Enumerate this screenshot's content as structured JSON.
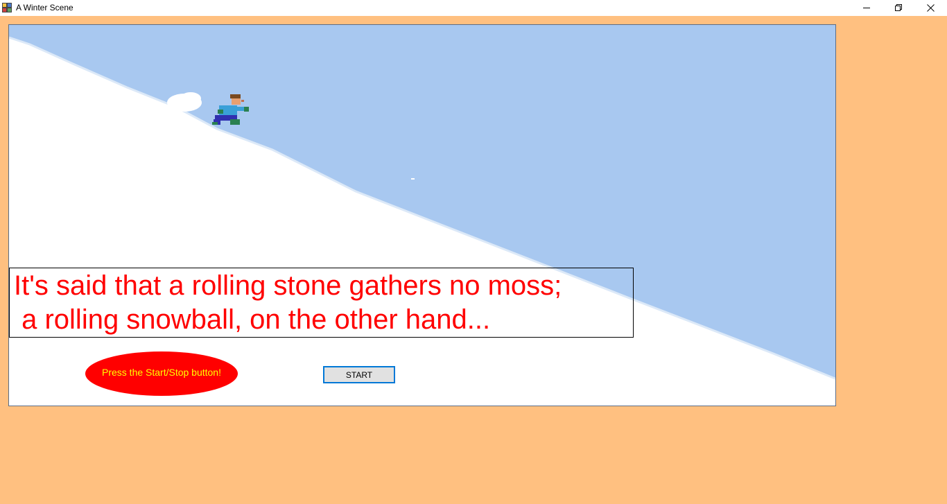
{
  "window": {
    "title": "A Winter Scene",
    "app_icon": "window-app-icon",
    "controls": [
      "minimize-icon",
      "restore-icon",
      "close-icon"
    ]
  },
  "scene": {
    "sky_color": "#A8C8F0",
    "snow_color": "#FFFFFF",
    "background_color": "#FFC080",
    "message": {
      "line1": "It's said that a rolling stone gathers no moss;",
      "line2": " a rolling snowball, on the other hand...",
      "color": "#FF0000"
    },
    "prompt": {
      "text": "Press the Start/Stop button!",
      "fill": "#FF0000",
      "text_color": "#FFFF00"
    },
    "start_button": {
      "label": "START"
    }
  }
}
